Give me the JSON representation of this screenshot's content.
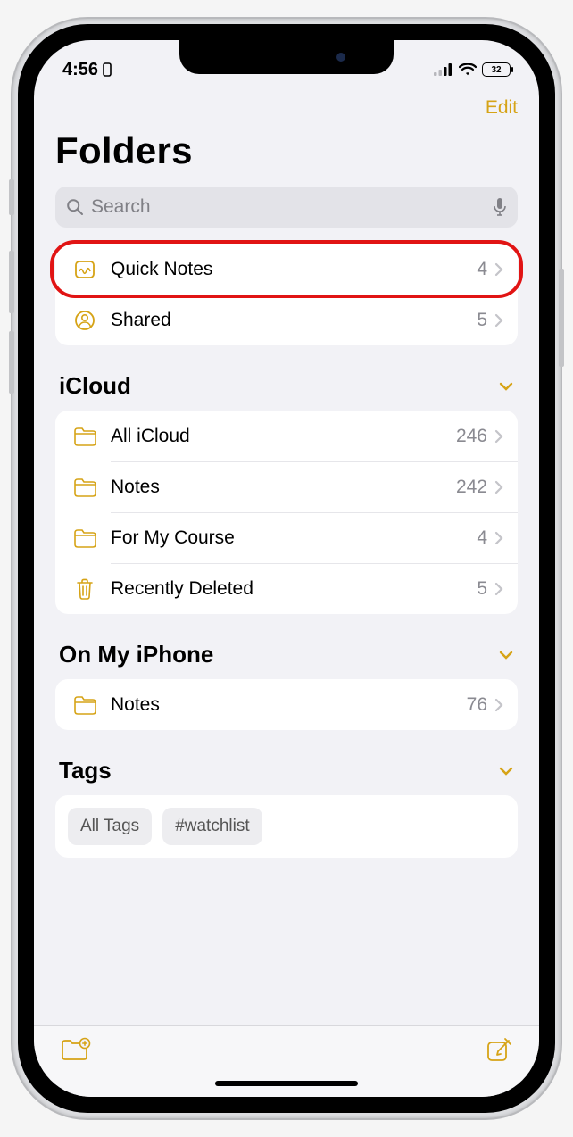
{
  "status": {
    "time": "4:56",
    "battery": "32"
  },
  "nav": {
    "edit": "Edit"
  },
  "header": {
    "title": "Folders"
  },
  "search": {
    "placeholder": "Search"
  },
  "top_rows": [
    {
      "label": "Quick Notes",
      "count": "4",
      "highlight": true
    },
    {
      "label": "Shared",
      "count": "5",
      "highlight": false
    }
  ],
  "sections": {
    "icloud": {
      "title": "iCloud",
      "rows": [
        {
          "label": "All iCloud",
          "count": "246"
        },
        {
          "label": "Notes",
          "count": "242"
        },
        {
          "label": "For My Course",
          "count": "4"
        },
        {
          "label": "Recently Deleted",
          "count": "5"
        }
      ]
    },
    "local": {
      "title": "On My iPhone",
      "rows": [
        {
          "label": "Notes",
          "count": "76"
        }
      ]
    },
    "tags": {
      "title": "Tags",
      "chips": [
        "All Tags",
        "#watchlist"
      ]
    }
  },
  "accent": "#d6a316"
}
